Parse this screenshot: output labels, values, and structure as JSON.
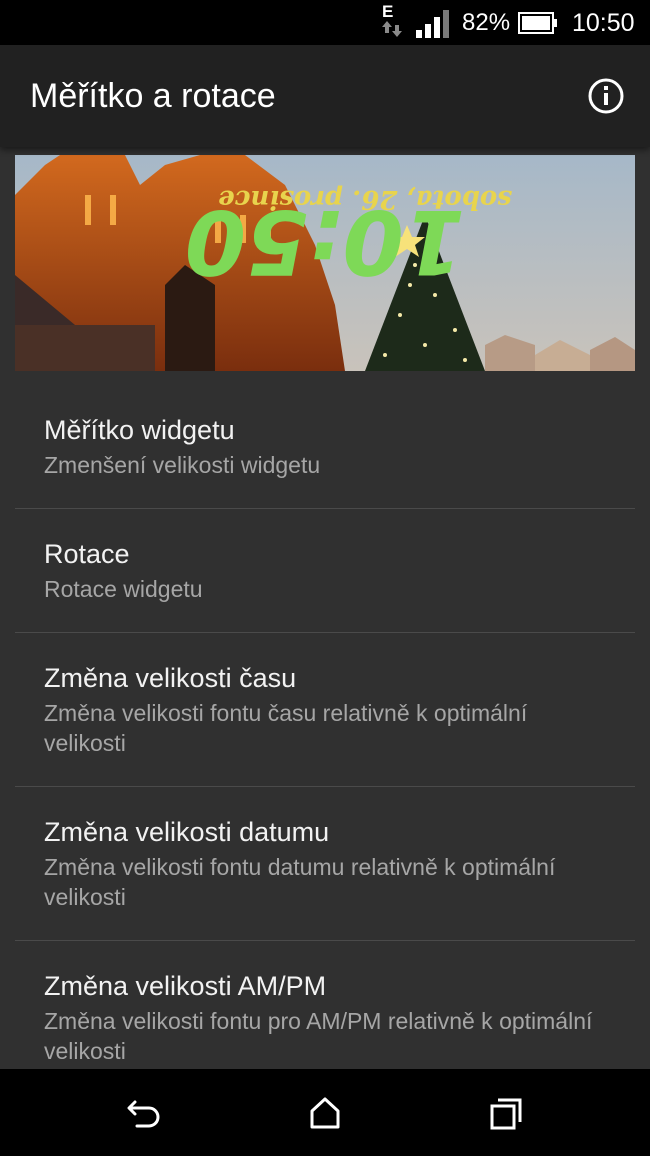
{
  "status_bar": {
    "network_type": "E",
    "battery_percent": "82%",
    "time": "10:50",
    "signal_level": 0.75,
    "battery_level": 0.82,
    "icons": [
      "data-arrows-icon",
      "signal-icon",
      "battery-icon"
    ]
  },
  "app_bar": {
    "title": "Měřítko a rotace",
    "info_icon": "info-icon"
  },
  "widget_preview": {
    "time": "10:50",
    "date": "sobota, 26. prosince",
    "rotation_degrees": 180,
    "time_color": "#7ed957",
    "date_color": "#e8d44d"
  },
  "settings": [
    {
      "title": "Měřítko widgetu",
      "subtitle": "Zmenšení velikosti widgetu"
    },
    {
      "title": "Rotace",
      "subtitle": "Rotace widgetu"
    },
    {
      "title": "Změna velikosti času",
      "subtitle": "Změna velikosti fontu času relativně k optimální velikosti"
    },
    {
      "title": "Změna velikosti datumu",
      "subtitle": "Změna velikosti fontu datumu relativně k optimální velikosti"
    },
    {
      "title": "Změna velikosti AM/PM",
      "subtitle": "Změna velikosti fontu pro AM/PM relativně k optimální velikosti"
    }
  ],
  "nav_bar": {
    "buttons": [
      "back-icon",
      "home-icon",
      "recents-icon"
    ]
  }
}
